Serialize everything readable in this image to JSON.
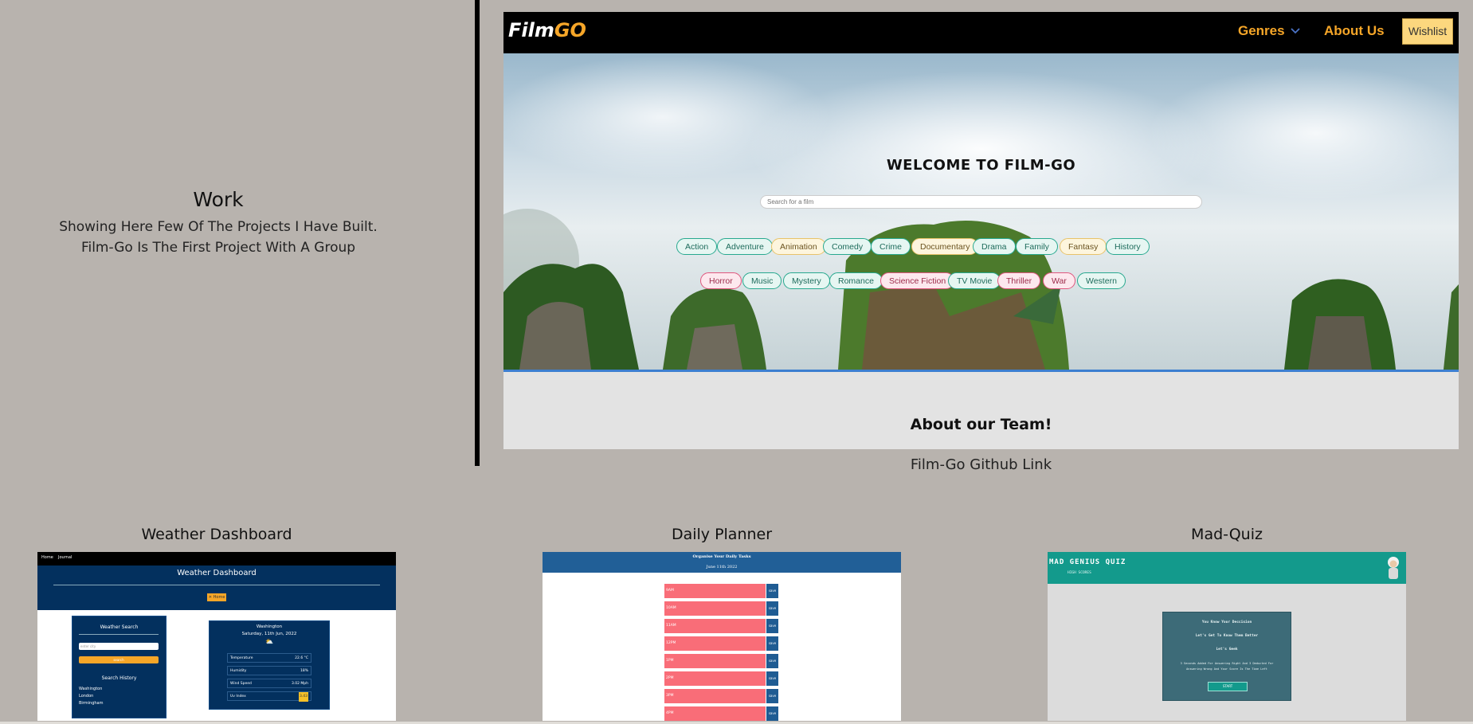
{
  "work": {
    "title": "Work",
    "desc_line1": "Showing Here Few Of The Projects I Have Built.",
    "desc_line2": "Film-Go Is The First Project With A Group"
  },
  "filmgo": {
    "logo_part1": "Film",
    "logo_part2": "GO",
    "nav_genres": "Genres",
    "nav_about": "About Us",
    "nav_wishlist": "Wishlist",
    "welcome": "WELCOME TO FILM-GO",
    "search_placeholder": "Search for a film",
    "genres_row1": [
      {
        "label": "Action",
        "style": "teal"
      },
      {
        "label": "Adventure",
        "style": "teal"
      },
      {
        "label": "Animation",
        "style": "yellow"
      },
      {
        "label": "Comedy",
        "style": "teal"
      },
      {
        "label": "Crime",
        "style": "teal"
      },
      {
        "label": "Documentary",
        "style": "yellow"
      },
      {
        "label": "Drama",
        "style": "teal"
      },
      {
        "label": "Family",
        "style": "teal"
      },
      {
        "label": "Fantasy",
        "style": "yellow"
      },
      {
        "label": "History",
        "style": "teal"
      }
    ],
    "genres_row2": [
      {
        "label": "Horror",
        "style": "pink"
      },
      {
        "label": "Music",
        "style": "teal"
      },
      {
        "label": "Mystery",
        "style": "teal"
      },
      {
        "label": "Romance",
        "style": "teal"
      },
      {
        "label": "Science Fiction",
        "style": "pink"
      },
      {
        "label": "TV Movie",
        "style": "teal"
      },
      {
        "label": "Thriller",
        "style": "pink"
      },
      {
        "label": "War",
        "style": "pink"
      },
      {
        "label": "Western",
        "style": "teal"
      }
    ],
    "team_heading": "About our Team!",
    "github_link": "Film-Go Github Link"
  },
  "projects": {
    "weather": {
      "title": "Weather Dashboard",
      "nav_home": "Home",
      "nav_journal": "Journal",
      "header": "Weather Dashboard",
      "header_button": "☀ Home",
      "search_title": "Weather Search",
      "search_placeholder": "enter city",
      "search_button": "search",
      "history_title": "Search History",
      "history": [
        "Washington",
        "London",
        "Birmingham"
      ],
      "city": "Washington",
      "date": "Saturday, 11th Jun, 2022",
      "rows": [
        {
          "label": "Temperature",
          "value": "22.6 °C"
        },
        {
          "label": "Humidity",
          "value": "18%"
        },
        {
          "label": "Wind Speed",
          "value": "3.02 Mph"
        },
        {
          "label": "Uv Index",
          "value": "3.43"
        }
      ]
    },
    "planner": {
      "title": "Daily Planner",
      "heading": "Organise Your Daily Tasks",
      "date": "June 11th 2022",
      "hours": [
        "9AM",
        "10AM",
        "11AM",
        "12PM",
        "1PM",
        "2PM",
        "3PM",
        "4PM"
      ],
      "save_label": "save"
    },
    "quiz": {
      "title": "Mad-Quiz",
      "app_title": "MAD GENIUS QUIZ",
      "high_scores": "HIGH SCORES",
      "line1": "You Know Your Deccision",
      "line2": "Let's Get To Know Them Better",
      "line3": "Let's Geek",
      "line4": "3 Seconds Added For Answering Right And 3 Deducted For",
      "line5": "Answering Wrong And Your Score Is The Time Left",
      "start": "START"
    }
  },
  "colors": {
    "page_bg": "#b8b3ae",
    "filmgo_accent": "#f6a628",
    "wishlist_bg": "#fcd77e",
    "weather_navy": "#03305e",
    "planner_blue": "#215f97",
    "planner_red": "#f96d78",
    "quiz_teal": "#139a8c"
  }
}
